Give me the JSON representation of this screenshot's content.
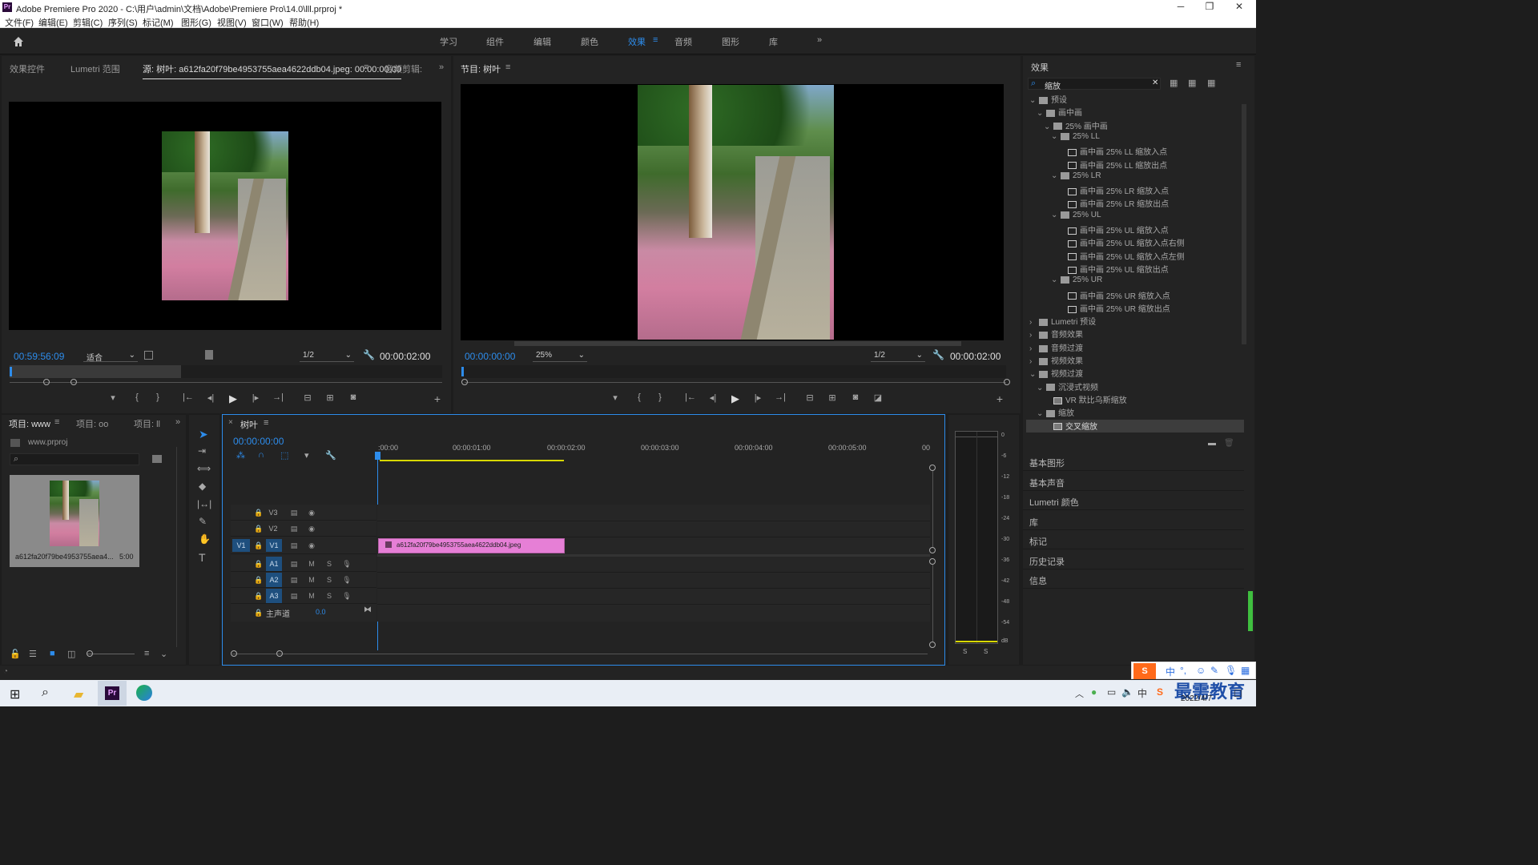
{
  "window": {
    "title": "Adobe Premiere Pro 2020 - C:\\用户\\admin\\文档\\Adobe\\Premiere Pro\\14.0\\lll.prproj *",
    "app_badge": "Pr",
    "controls": [
      "─",
      "❐",
      "✕"
    ]
  },
  "menu": [
    "文件(F)",
    "编辑(E)",
    "剪辑(C)",
    "序列(S)",
    "标记(M)",
    "图形(G)",
    "视图(V)",
    "窗口(W)",
    "帮助(H)"
  ],
  "workspaces": {
    "tabs": [
      "学习",
      "组件",
      "编辑",
      "颜色",
      "效果",
      "音频",
      "图形",
      "库"
    ],
    "active": "效果",
    "more": "»"
  },
  "source": {
    "tabs": [
      "效果控件",
      "Lumetri 范围",
      "源: 树叶: a612fa20f79be4953755aea4622ddb04.jpeg: 00:00:00:00",
      "音频剪辑:"
    ],
    "timecode": "00:59:56:09",
    "fit": "适合",
    "resolution": "1/2",
    "duration": "00:00:02:00"
  },
  "program": {
    "title": "节目: 树叶",
    "timecode": "00:00:00:00",
    "zoom": "25%",
    "resolution": "1/2",
    "duration": "00:00:02:00"
  },
  "project": {
    "tabs": [
      "项目: www",
      "项目: oo",
      "项目: ll"
    ],
    "file": "www.prproj",
    "clip_name": "a612fa20f79be4953755aea4...",
    "clip_duration": "5:00"
  },
  "timeline": {
    "sequence": "树叶",
    "timecode": "00:00:00:00",
    "ruler": [
      ":00:00",
      "00:00:01:00",
      "00:00:02:00",
      "00:00:03:00",
      "00:00:04:00",
      "00:00:05:00",
      "00"
    ],
    "video_tracks": [
      "V3",
      "V2",
      "V1"
    ],
    "audio_tracks": [
      "A1",
      "A2",
      "A3"
    ],
    "source_patch": "V1",
    "master_label": "主声道",
    "master_value": "0.0",
    "clip_label": "a612fa20f79be4953755aea4622ddb04.jpeg",
    "clip_color": "#e67fd6",
    "audio_buttons": [
      "M",
      "S"
    ]
  },
  "meter": {
    "scale": [
      "0",
      "-6",
      "-12",
      "-18",
      "-24",
      "-30",
      "-36",
      "-42",
      "-48",
      "-54",
      "dB"
    ],
    "solo": [
      "S",
      "S"
    ]
  },
  "effects": {
    "title": "效果",
    "search_value": "缩放",
    "tree": [
      {
        "label": "预设",
        "type": "folder",
        "depth": 0,
        "open": true
      },
      {
        "label": "画中画",
        "type": "folder",
        "depth": 1,
        "open": true
      },
      {
        "label": "25% 画中画",
        "type": "folder",
        "depth": 2,
        "open": true
      },
      {
        "label": "25% LL",
        "type": "folder",
        "depth": 3,
        "open": true
      },
      {
        "label": "画中画 25% LL 缩放入点",
        "type": "preset",
        "depth": 4
      },
      {
        "label": "画中画 25% LL 缩放出点",
        "type": "preset",
        "depth": 4
      },
      {
        "label": "25% LR",
        "type": "folder",
        "depth": 3,
        "open": true
      },
      {
        "label": "画中画 25% LR 缩放入点",
        "type": "preset",
        "depth": 4
      },
      {
        "label": "画中画 25% LR 缩放出点",
        "type": "preset",
        "depth": 4
      },
      {
        "label": "25% UL",
        "type": "folder",
        "depth": 3,
        "open": true
      },
      {
        "label": "画中画 25% UL 缩放入点",
        "type": "preset",
        "depth": 4
      },
      {
        "label": "画中画 25% UL 缩放入点右侧",
        "type": "preset",
        "depth": 4
      },
      {
        "label": "画中画 25% UL 缩放入点左侧",
        "type": "preset",
        "depth": 4
      },
      {
        "label": "画中画 25% UL 缩放出点",
        "type": "preset",
        "depth": 4
      },
      {
        "label": "25% UR",
        "type": "folder",
        "depth": 3,
        "open": true
      },
      {
        "label": "画中画 25% UR 缩放入点",
        "type": "preset",
        "depth": 4
      },
      {
        "label": "画中画 25% UR 缩放出点",
        "type": "preset",
        "depth": 4
      },
      {
        "label": "Lumetri 预设",
        "type": "folder",
        "depth": 0,
        "open": false
      },
      {
        "label": "音频效果",
        "type": "folder",
        "depth": 0,
        "open": false
      },
      {
        "label": "音频过渡",
        "type": "folder",
        "depth": 0,
        "open": false
      },
      {
        "label": "视频效果",
        "type": "folder",
        "depth": 0,
        "open": false
      },
      {
        "label": "视频过渡",
        "type": "folder",
        "depth": 0,
        "open": true
      },
      {
        "label": "沉浸式视频",
        "type": "folder",
        "depth": 1,
        "open": true
      },
      {
        "label": "VR 默比乌斯缩放",
        "type": "effect",
        "depth": 2
      },
      {
        "label": "缩放",
        "type": "folder",
        "depth": 1,
        "open": true
      },
      {
        "label": "交叉缩放",
        "type": "effect",
        "depth": 2,
        "selected": true
      }
    ],
    "side_panels": [
      "基本图形",
      "基本声音",
      "Lumetri 颜色",
      "库",
      "标记",
      "历史记录",
      "信息"
    ]
  },
  "taskbar": {
    "date": "2022/4/7",
    "ime": "中",
    "watermark": "最需教育"
  }
}
